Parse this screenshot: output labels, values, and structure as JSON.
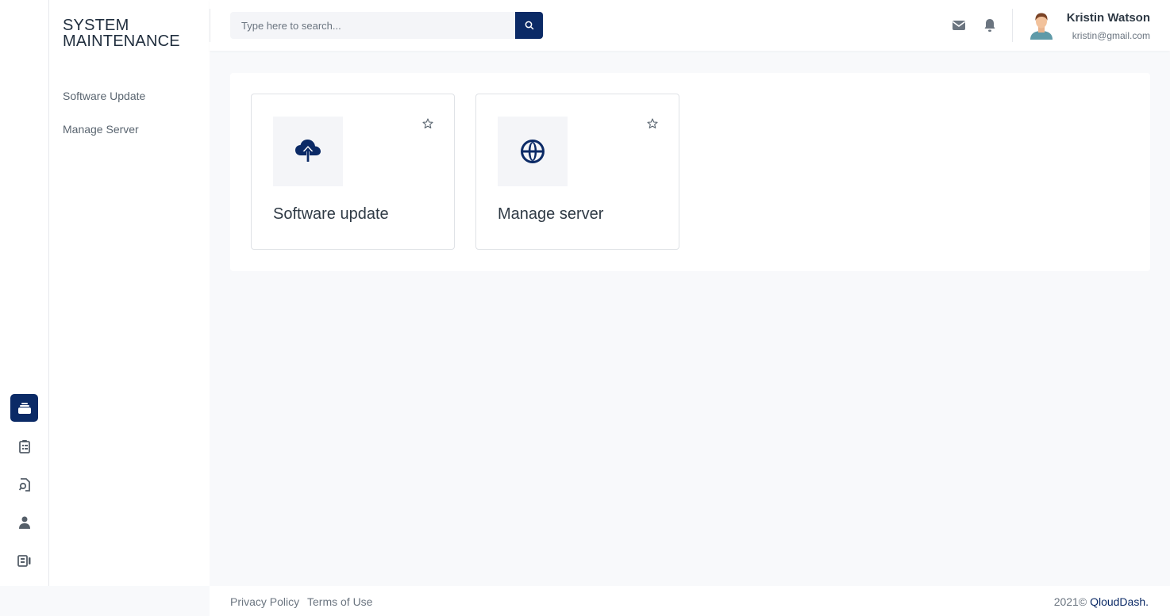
{
  "brand": {
    "line1": "SYSTEM",
    "line2": "MAINTENANCE"
  },
  "sidebar": {
    "links": [
      {
        "label": "Software Update"
      },
      {
        "label": "Manage Server"
      }
    ]
  },
  "rail": {
    "items": [
      {
        "icon": "toolbox-icon",
        "active": true
      },
      {
        "icon": "clipboard-list-icon",
        "active": false
      },
      {
        "icon": "search-document-icon",
        "active": false
      },
      {
        "icon": "user-icon",
        "active": false
      },
      {
        "icon": "id-card-icon",
        "active": false
      }
    ]
  },
  "header": {
    "search": {
      "placeholder": "Type here to search...",
      "value": ""
    },
    "user": {
      "name": "Kristin Watson",
      "email": "kristin@gmail.com"
    }
  },
  "cards": [
    {
      "title": "Software update",
      "icon": "cloud-upload-icon"
    },
    {
      "title": "Manage server",
      "icon": "globe-icon"
    }
  ],
  "footer": {
    "privacy": "Privacy Policy",
    "terms": "Terms of Use",
    "copyright_prefix": "2021©",
    "copyright_brand": "QloudDash",
    "copyright_suffix": "."
  },
  "colors": {
    "primary": "#0b2a66",
    "background": "#f8f9fb",
    "text": "#2f3a45"
  }
}
